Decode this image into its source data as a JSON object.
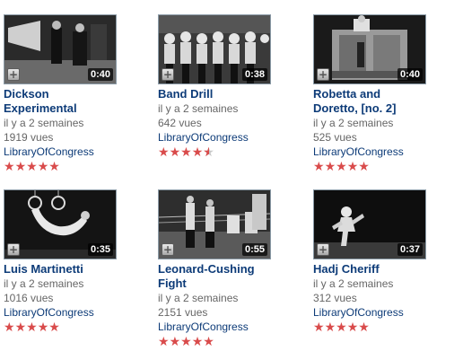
{
  "colors": {
    "title": "#0d3b78",
    "meta": "#666666",
    "star": "#d94b4b",
    "star_empty": "#c8c8c8"
  },
  "icons": {
    "add": "plus-icon",
    "rating": "star-icon"
  },
  "videos": [
    {
      "title": "Dickson Experimental",
      "duration": "0:40",
      "age": "il y a 2 semaines",
      "views": "1919 vues",
      "channel": "LibraryOfCongress",
      "rating": 5
    },
    {
      "title": "Band Drill",
      "duration": "0:38",
      "age": "il y a 2 semaines",
      "views": "642 vues",
      "channel": "LibraryOfCongress",
      "rating": 4.5
    },
    {
      "title": "Robetta and Doretto, [no. 2]",
      "duration": "0:40",
      "age": "il y a 2 semaines",
      "views": "525 vues",
      "channel": "LibraryOfCongress",
      "rating": 5
    },
    {
      "title": "Luis Martinetti",
      "duration": "0:35",
      "age": "il y a 2 semaines",
      "views": "1016 vues",
      "channel": "LibraryOfCongress",
      "rating": 5
    },
    {
      "title": "Leonard-Cushing Fight",
      "duration": "0:55",
      "age": "il y a 2 semaines",
      "views": "2151 vues",
      "channel": "LibraryOfCongress",
      "rating": 5
    },
    {
      "title": "Hadj Cheriff",
      "duration": "0:37",
      "age": "il y a 2 semaines",
      "views": "312 vues",
      "channel": "LibraryOfCongress",
      "rating": 5
    }
  ]
}
